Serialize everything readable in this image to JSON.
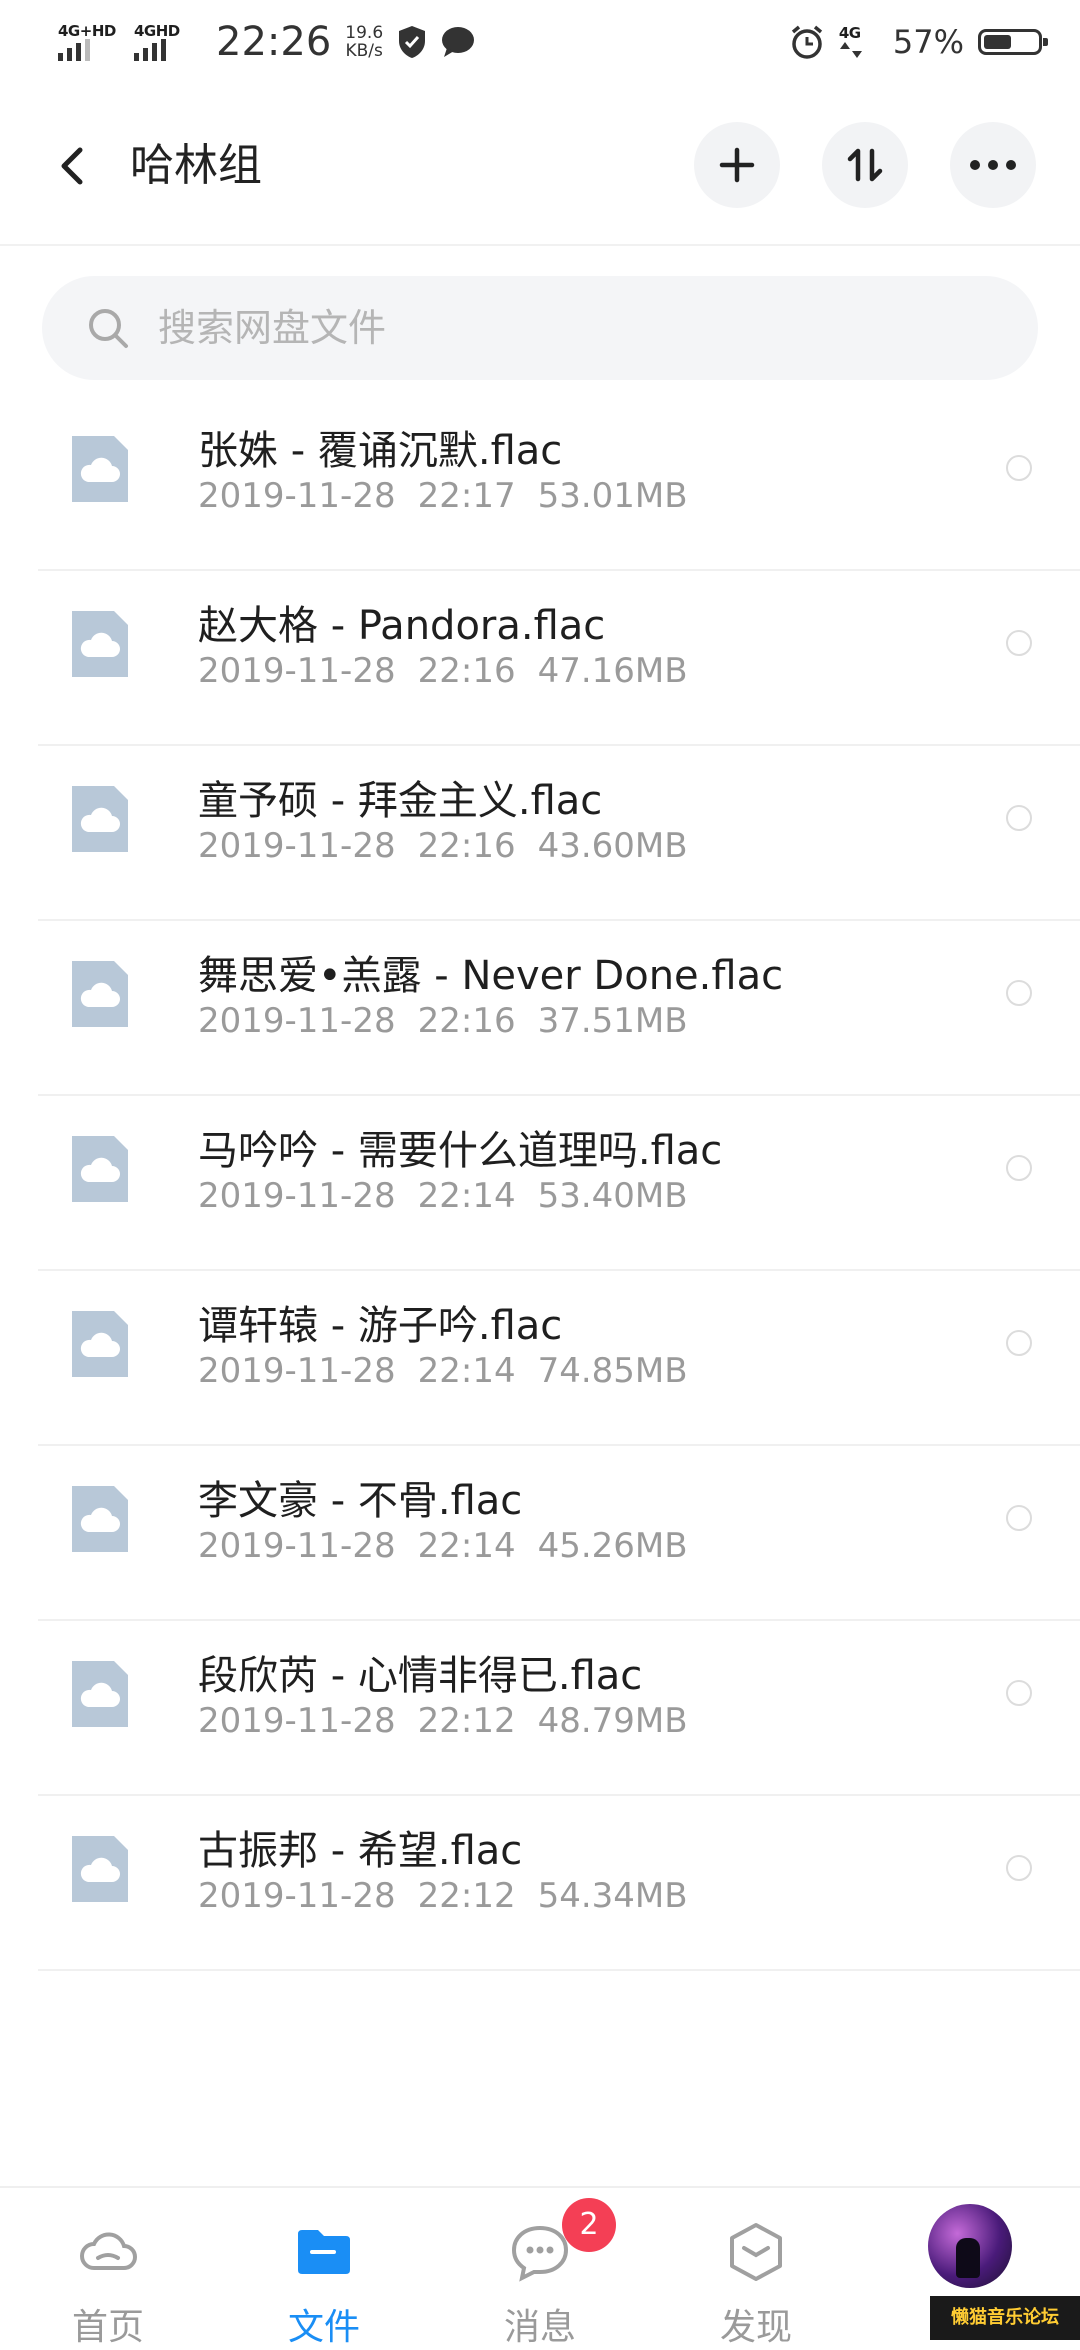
{
  "statusbar": {
    "net1": "4G+HD",
    "net2": "4GHD",
    "time": "22:26",
    "speed_value": "19.6",
    "speed_unit": "KB/s",
    "net3": "4G",
    "battery_pct": "57%",
    "battery_level": 0.57
  },
  "header": {
    "title": "哈林组"
  },
  "search": {
    "placeholder": "搜索网盘文件"
  },
  "files": [
    {
      "name": "张姝 - 覆诵沉默.flac",
      "date": "2019-11-28",
      "time": "22:17",
      "size": "53.01MB"
    },
    {
      "name": "赵大格 - Pandora.flac",
      "date": "2019-11-28",
      "time": "22:16",
      "size": "47.16MB"
    },
    {
      "name": "童予硕 - 拜金主义.flac",
      "date": "2019-11-28",
      "time": "22:16",
      "size": "43.60MB"
    },
    {
      "name": "舞思爱•羔露 - Never Done.flac",
      "date": "2019-11-28",
      "time": "22:16",
      "size": "37.51MB"
    },
    {
      "name": "马吟吟 - 需要什么道理吗.flac",
      "date": "2019-11-28",
      "time": "22:14",
      "size": "53.40MB"
    },
    {
      "name": "谭轩辕 - 游子吟.flac",
      "date": "2019-11-28",
      "time": "22:14",
      "size": "74.85MB"
    },
    {
      "name": "李文豪 - 不骨.flac",
      "date": "2019-11-28",
      "time": "22:14",
      "size": "45.26MB"
    },
    {
      "name": "段欣芮 - 心情非得已.flac",
      "date": "2019-11-28",
      "time": "22:12",
      "size": "48.79MB"
    },
    {
      "name": "古振邦 - 希望.flac",
      "date": "2019-11-28",
      "time": "22:12",
      "size": "54.34MB"
    }
  ],
  "nav": {
    "home": "首页",
    "files": "文件",
    "messages": "消息",
    "messages_badge": "2",
    "discover": "发现"
  },
  "watermark": "懒猫音乐论坛",
  "colors": {
    "accent": "#1a8ef5",
    "badge": "#f43f55",
    "file_icon": "#b8c8d8"
  }
}
